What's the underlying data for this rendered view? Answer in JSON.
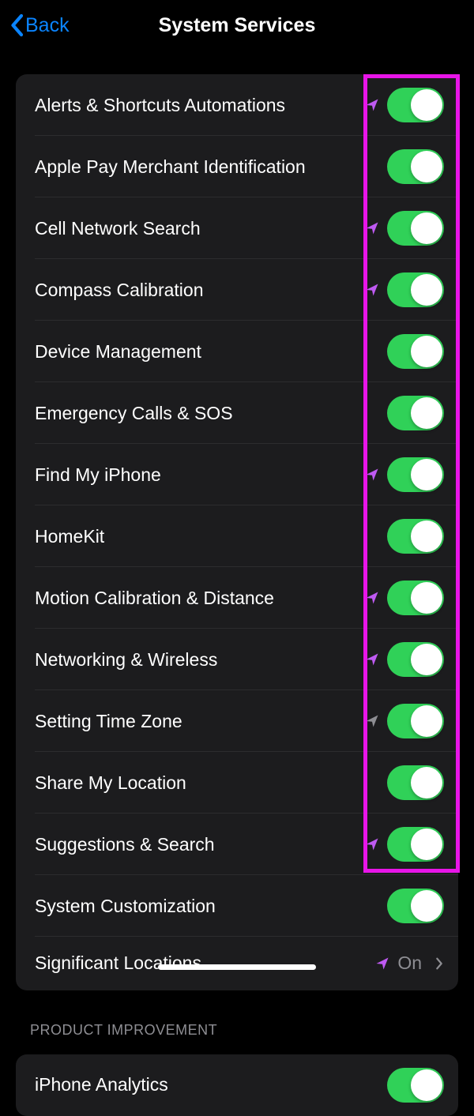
{
  "header": {
    "back_label": "Back",
    "title": "System Services"
  },
  "section1": {
    "items": [
      {
        "label": "Alerts & Shortcuts Automations",
        "arrow": "purple",
        "toggle": true
      },
      {
        "label": "Apple Pay Merchant Identification",
        "arrow": "none",
        "toggle": true
      },
      {
        "label": "Cell Network Search",
        "arrow": "purple",
        "toggle": true
      },
      {
        "label": "Compass Calibration",
        "arrow": "purple",
        "toggle": true
      },
      {
        "label": "Device Management",
        "arrow": "none",
        "toggle": true
      },
      {
        "label": "Emergency Calls & SOS",
        "arrow": "none",
        "toggle": true
      },
      {
        "label": "Find My iPhone",
        "arrow": "purple",
        "toggle": true
      },
      {
        "label": "HomeKit",
        "arrow": "none",
        "toggle": true
      },
      {
        "label": "Motion Calibration & Distance",
        "arrow": "purple",
        "toggle": true
      },
      {
        "label": "Networking & Wireless",
        "arrow": "purple",
        "toggle": true
      },
      {
        "label": "Setting Time Zone",
        "arrow": "gray",
        "toggle": true
      },
      {
        "label": "Share My Location",
        "arrow": "none",
        "toggle": true
      },
      {
        "label": "Suggestions & Search",
        "arrow": "purple",
        "toggle": true
      },
      {
        "label": "System Customization",
        "arrow": "none",
        "toggle": true
      },
      {
        "label": "Significant Locations",
        "arrow": "purple",
        "detail": "On",
        "chevron": true
      }
    ]
  },
  "section2": {
    "header": "PRODUCT IMPROVEMENT",
    "items": [
      {
        "label": "iPhone Analytics",
        "arrow": "none",
        "toggle": true
      }
    ]
  }
}
